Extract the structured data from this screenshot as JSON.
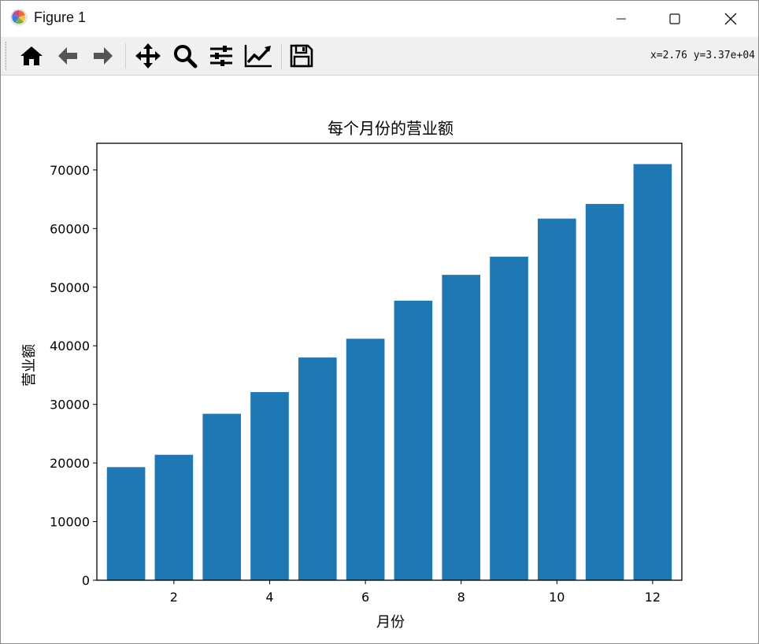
{
  "window": {
    "title": "Figure 1",
    "app_icon": "matplotlib-icon",
    "controls": [
      "minimize-icon",
      "maximize-icon",
      "close-icon"
    ]
  },
  "toolbar": {
    "buttons": [
      {
        "name": "home-button",
        "icon": "home-icon"
      },
      {
        "name": "back-button",
        "icon": "arrow-left-icon"
      },
      {
        "name": "forward-button",
        "icon": "arrow-right-icon"
      },
      {
        "name": "pan-button",
        "icon": "move-icon"
      },
      {
        "name": "zoom-button",
        "icon": "magnifier-icon"
      },
      {
        "name": "subplots-button",
        "icon": "sliders-icon"
      },
      {
        "name": "edit-axes-button",
        "icon": "line-chart-icon"
      },
      {
        "name": "save-button",
        "icon": "floppy-disk-icon"
      }
    ],
    "coordinates": "x=2.76  y=3.37e+04"
  },
  "chart_data": {
    "type": "bar",
    "title": "每个月份的营业额",
    "xlabel": "月份",
    "ylabel": "营业额",
    "categories": [
      1,
      2,
      3,
      4,
      5,
      6,
      7,
      8,
      9,
      10,
      11,
      12
    ],
    "values": [
      19300,
      21400,
      28400,
      32100,
      38000,
      41200,
      47700,
      52100,
      55200,
      61700,
      64200,
      71000
    ],
    "xlim": [
      0.39,
      12.61
    ],
    "ylim": [
      0,
      74550
    ],
    "xticks": [
      2,
      4,
      6,
      8,
      10,
      12
    ],
    "yticks": [
      0,
      10000,
      20000,
      30000,
      40000,
      50000,
      60000,
      70000
    ],
    "bar_color": "#1f77b4",
    "grid": false
  }
}
